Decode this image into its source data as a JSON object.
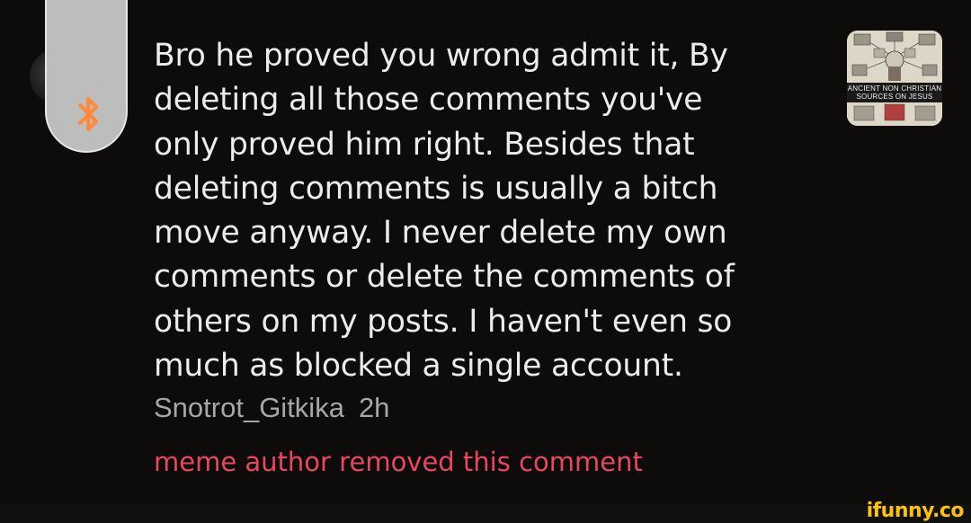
{
  "comment": {
    "lines": [
      "Bro he proved you wrong admit it, By",
      "deleting all those comments you've",
      "only proved him right. Besides that",
      "deleting comments is usually a bitch",
      "move anyway. I never delete my own",
      "comments or delete the comments of",
      "others on my posts. I haven't even so",
      "much as blocked a single account."
    ],
    "author": "Snotrot_Gitkika",
    "time": "2h"
  },
  "notice": {
    "removed": "meme author removed this comment"
  },
  "thumbnail": {
    "caption_line1": "ANCIENT NON CHRISTIAN",
    "caption_line2": "SOURCES ON JESUS"
  },
  "overlay": {
    "icon": "bluetooth-icon"
  },
  "watermark": "ifunny.co",
  "colors": {
    "background": "#0e0b0b",
    "text": "#ececec",
    "meta": "#a7a7a7",
    "removed": "#e8475e",
    "bluetooth": "#ff8a3d",
    "watermark": "#ffc300"
  }
}
